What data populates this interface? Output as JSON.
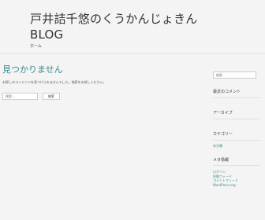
{
  "header": {
    "title_line1": "戸井詰千悠のくうかんじょきん",
    "title_line2": "BLOG",
    "home_link": "ホーム"
  },
  "main": {
    "title": "見つかりません",
    "message": "お探しのコンテンツを見つけられませんでした。検索をお試しください。",
    "search_placeholder": "検索…",
    "search_button": "検索"
  },
  "sidebar": {
    "search_placeholder": "検索…",
    "recent_comments_heading": "最近のコメント",
    "archives_heading": "アーカイブ",
    "categories_heading": "カテゴリー",
    "category_item": "未分類",
    "meta_heading": "メタ情報",
    "meta_items": [
      "ログイン",
      "投稿フィード",
      "コメントフィード",
      "WordPress.org"
    ]
  },
  "colors": {
    "accent": "#3a8a8a",
    "background": "#f4f4f4",
    "text": "#333333"
  }
}
